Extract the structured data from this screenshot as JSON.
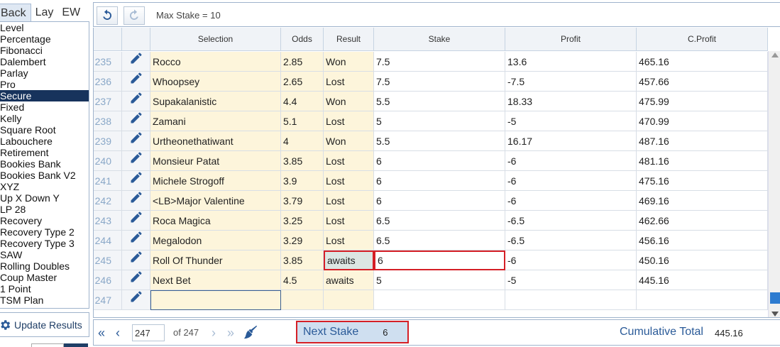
{
  "mode_tabs": [
    {
      "label": "Back",
      "active": true
    },
    {
      "label": "Lay",
      "active": false
    },
    {
      "label": "EW",
      "active": false
    }
  ],
  "staking_methods": [
    "Level",
    "Percentage",
    "Fibonacci",
    "Dalembert",
    "Parlay",
    "Pro",
    "Secure",
    "Fixed",
    "Kelly",
    "Square Root",
    "Labouchere",
    "Retirement",
    "Bookies Bank",
    "Bookies Bank V2",
    "XYZ",
    "Up X Down Y",
    "LP 28",
    "Recovery",
    "Recovery Type 2",
    "Recovery Type 3",
    "SAW",
    "Rolling Doubles",
    "Coup Master",
    "1 Point",
    "TSM Plan"
  ],
  "active_staking_method": "Secure",
  "update_results_label": "Update Results",
  "toolbar": {
    "undo_icon": "undo-icon",
    "redo_icon": "redo-icon",
    "max_stake": "Max Stake = 10"
  },
  "columns": [
    "",
    "",
    "Selection",
    "Odds",
    "Result",
    "Stake",
    "Profit",
    "C.Profit"
  ],
  "rows": [
    {
      "n": "235",
      "selection": "Rocco",
      "odds": "2.85",
      "result": "Won",
      "stake": "7.5",
      "profit": "13.6",
      "cprofit": "465.16"
    },
    {
      "n": "236",
      "selection": "Whoopsey",
      "odds": "2.65",
      "result": "Lost",
      "stake": "7.5",
      "profit": "-7.5",
      "cprofit": "457.66"
    },
    {
      "n": "237",
      "selection": "Supakalanistic",
      "odds": "4.4",
      "result": "Won",
      "stake": "5.5",
      "profit": "18.33",
      "cprofit": "475.99"
    },
    {
      "n": "238",
      "selection": "Zamani",
      "odds": "5.1",
      "result": "Lost",
      "stake": "5",
      "profit": "-5",
      "cprofit": "470.99"
    },
    {
      "n": "239",
      "selection": "Urtheonethatiwant",
      "odds": "4",
      "result": "Won",
      "stake": "5.5",
      "profit": "16.17",
      "cprofit": "487.16"
    },
    {
      "n": "240",
      "selection": "Monsieur Patat",
      "odds": "3.85",
      "result": "Lost",
      "stake": "6",
      "profit": "-6",
      "cprofit": "481.16"
    },
    {
      "n": "241",
      "selection": "Michele Strogoff",
      "odds": "3.9",
      "result": "Lost",
      "stake": "6",
      "profit": "-6",
      "cprofit": "475.16"
    },
    {
      "n": "242",
      "selection": "<LB>Major Valentine",
      "odds": "3.79",
      "result": "Lost",
      "stake": "6",
      "profit": "-6",
      "cprofit": "469.16"
    },
    {
      "n": "243",
      "selection": "Roca Magica",
      "odds": "3.25",
      "result": "Lost",
      "stake": "6.5",
      "profit": "-6.5",
      "cprofit": "462.66"
    },
    {
      "n": "244",
      "selection": "Megalodon",
      "odds": "3.29",
      "result": "Lost",
      "stake": "6.5",
      "profit": "-6.5",
      "cprofit": "456.16"
    },
    {
      "n": "245",
      "selection": "Roll Of Thunder",
      "odds": "3.85",
      "result": "awaits",
      "stake": "6",
      "profit": "-6",
      "cprofit": "450.16",
      "highlight": true
    },
    {
      "n": "246",
      "selection": "Next Bet",
      "odds": "4.5",
      "result": "awaits",
      "stake": "5",
      "profit": "-5",
      "cprofit": "445.16"
    },
    {
      "n": "247",
      "selection": "",
      "odds": "",
      "result": "",
      "stake": "",
      "profit": "",
      "cprofit": "",
      "new_row": true
    }
  ],
  "pager": {
    "page": "247",
    "of_label": "of 247"
  },
  "next_stake": {
    "label": "Next Stake",
    "value": "6"
  },
  "cumulative": {
    "label": "Cumulative Total",
    "value": "445.16"
  },
  "colors": {
    "active_bg": "#17335c",
    "highlight_border": "#d51f26",
    "input_cell_bg": "#fdf5db",
    "link_blue": "#2a5a98"
  }
}
